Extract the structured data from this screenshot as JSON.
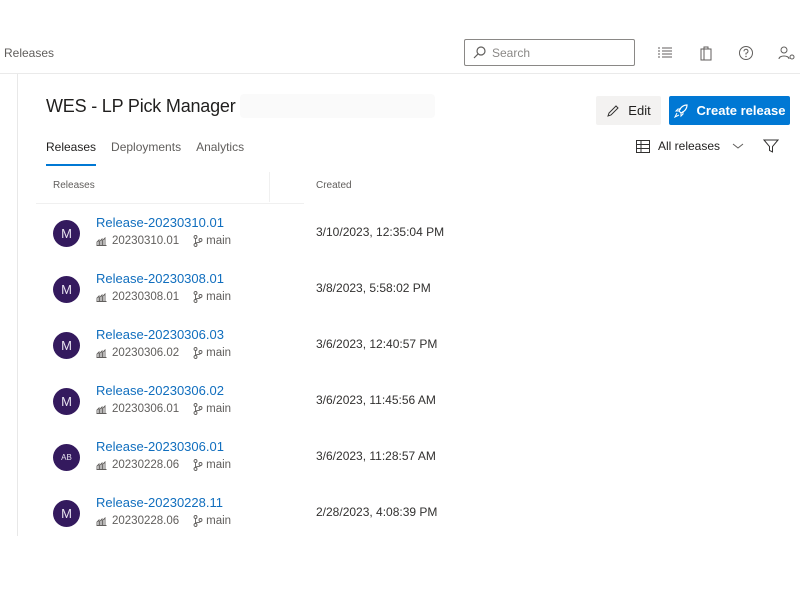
{
  "header": {
    "breadcrumb": "Releases",
    "search_placeholder": "Search",
    "icons": [
      "list-icon",
      "shopping-bag-icon",
      "help-icon",
      "user-settings-icon"
    ]
  },
  "page": {
    "title": "WES - LP Pick Manager",
    "edit_label": "Edit",
    "create_label": "Create release",
    "tabs": [
      {
        "label": "Releases",
        "active": true
      },
      {
        "label": "Deployments",
        "active": false
      },
      {
        "label": "Analytics",
        "active": false
      }
    ],
    "view_select": "All releases"
  },
  "table": {
    "columns": [
      "Releases",
      "Created"
    ],
    "rows": [
      {
        "avatar": "M",
        "name": "Release-20230310.01",
        "build": "20230310.01",
        "branch": "main",
        "created": "3/10/2023, 12:35:04 PM"
      },
      {
        "avatar": "M",
        "name": "Release-20230308.01",
        "build": "20230308.01",
        "branch": "main",
        "created": "3/8/2023, 5:58:02 PM"
      },
      {
        "avatar": "M",
        "name": "Release-20230306.03",
        "build": "20230306.02",
        "branch": "main",
        "created": "3/6/2023, 12:40:57 PM"
      },
      {
        "avatar": "M",
        "name": "Release-20230306.02",
        "build": "20230306.01",
        "branch": "main",
        "created": "3/6/2023, 11:45:56 AM"
      },
      {
        "avatar": "AB",
        "name": "Release-20230306.01",
        "build": "20230228.06",
        "branch": "main",
        "created": "3/6/2023, 11:28:57 AM"
      },
      {
        "avatar": "M",
        "name": "Release-20230228.11",
        "build": "20230228.06",
        "branch": "main",
        "created": "2/28/2023, 4:08:39 PM"
      }
    ]
  },
  "colors": {
    "accent": "#0078d4",
    "link": "#106ebe",
    "avatar": "#341a5e"
  }
}
